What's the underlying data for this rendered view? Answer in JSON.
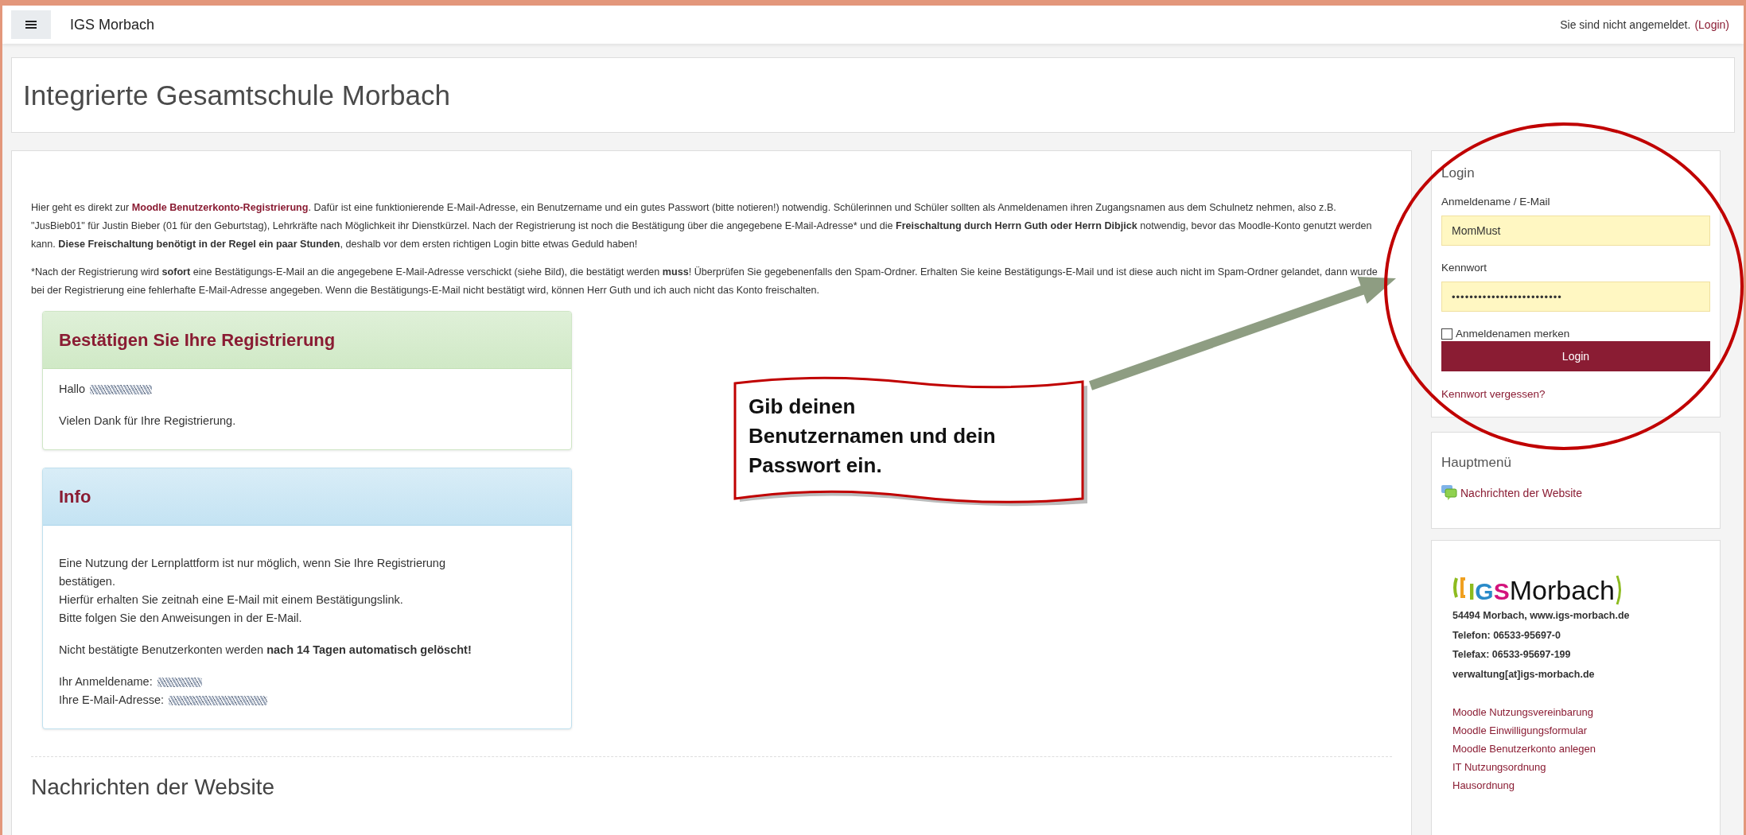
{
  "navbar": {
    "site_name": "IGS Morbach",
    "status": "Sie sind nicht angemeldet.",
    "login_link": "(Login)"
  },
  "header": {
    "title": "Integrierte Gesamtschule Morbach"
  },
  "intro": {
    "paragraphs": [
      [
        {
          "kind": "text",
          "text": "Hier geht es direkt zur "
        },
        {
          "kind": "link",
          "text": "Moodle Benutzerkonto-Registrierung"
        },
        {
          "kind": "text",
          "text": ". Dafür ist eine funktionierende E-Mail-Adresse, ein Benutzername und ein gutes Passwort (bitte notieren!) notwendig. Schülerinnen und Schüler sollten als Anmeldenamen ihren Zugangsnamen aus dem Schulnetz nehmen, also z.B. \"JusBieb01\" für Justin Bieber (01 für den Geburtstag), Lehrkräfte nach Möglichkeit ihr Dienstkürzel. Nach der Registrierung ist noch die Bestätigung über die angegebene E-Mail-Adresse* und die **Freischaltung durch Herrn Guth oder Herrn Dibjick** notwendig, bevor das Moodle-Konto genutzt werden kann. **Diese Freischaltung benötigt in der Regel ein paar Stunden**, deshalb vor dem ersten richtigen Login bitte etwas Geduld haben!"
        }
      ],
      [
        {
          "kind": "text",
          "text": "*Nach der Registrierung wird **sofort** eine Bestätigungs-E-Mail an die angegebene E-Mail-Adresse verschickt (siehe Bild), die bestätigt werden **muss**! Überprüfen Sie gegebenenfalls den Spam-Ordner. Erhalten Sie keine Bestätigungs-E-Mail und ist diese auch nicht im Spam-Ordner gelandet, dann wurde bei der Registrierung eine fehlerhafte E-Mail-Adresse angegeben. Wenn die Bestätigungs-E-Mail nicht bestätigt wird, können Herr Guth und ich auch nicht das Konto freischalten."
        }
      ]
    ]
  },
  "confirm_card": {
    "title": "Bestätigen Sie Ihre Registrierung",
    "greeting": "Hallo",
    "thanks": "Vielen Dank für Ihre Registrierung."
  },
  "info_card": {
    "title": "Info",
    "lines": [
      "Eine Nutzung der Lernplattform ist nur möglich, wenn Sie Ihre Registrierung bestätigen.",
      "Hierfür erhalten Sie zeitnah eine E-Mail mit einem Bestätigungslink.",
      "Bitte folgen Sie den Anweisungen in der E-Mail."
    ],
    "notice": "Nicht bestätigte Benutzerkonten werden **nach 14 Tagen automatisch gelöscht!**",
    "username_label": "Ihr Anmeldename:",
    "email_label": "Ihre E-Mail-Adresse:"
  },
  "news_heading": "Nachrichten der Website",
  "login": {
    "title": "Login",
    "username_label": "Anmeldename / E-Mail",
    "username": "MomMust",
    "password_label": "Kennwort",
    "password": "•••••••••••••••••••••••••",
    "remember": {
      "label": "Anmeldenamen merken",
      "checked": false
    },
    "button": "Login",
    "forgot": "Kennwort vergessen?"
  },
  "main_menu": {
    "title": "Hauptmenü",
    "items": [
      {
        "label": "Nachrichten der Website"
      }
    ]
  },
  "school": {
    "logo": {
      "mark": "IGS",
      "name": "Morbach"
    },
    "contact": [
      "54494 Morbach, www.igs-morbach.de",
      "Telefon: 06533-95697-0",
      "Telefax: 06533-95697-199",
      "verwaltung[at]igs-morbach.de"
    ],
    "links": [
      "Moodle Nutzungsvereinbarung",
      "Moodle Einwilligungsformular",
      "Moodle Benutzerkonto anlegen",
      "IT Nutzungsordnung",
      "Hausordnung"
    ]
  },
  "annotation": {
    "callout_lines": [
      "Gib deinen",
      "Benutzernamen und dein",
      "Passwort ein."
    ]
  }
}
